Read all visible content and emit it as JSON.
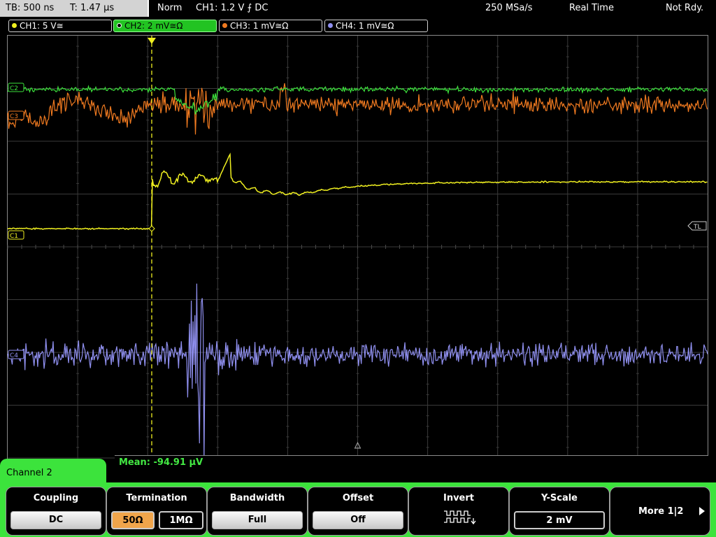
{
  "status": {
    "timebase": "TB: 500 ns",
    "trigger_time": "T: 1.47 µs",
    "trigger_mode": "Norm",
    "trigger_setting": "CH1: 1.2 V ⨍ DC",
    "sample_rate": "250 MSa/s",
    "acq_mode": "Real Time",
    "ready_state": "Not Rdy."
  },
  "channel_tabs": [
    {
      "label": "CH1: 5 V≅",
      "color": "#f0f020"
    },
    {
      "label": "CH2: 2 mV≅Ω",
      "color": "#3ce33c"
    },
    {
      "label": "CH3: 1 mV≅Ω",
      "color": "#f07a20"
    },
    {
      "label": "CH4: 1 mV≅Ω",
      "color": "#9090f0"
    }
  ],
  "markers": {
    "ch2": "C2",
    "ch3": "C3",
    "ch1": "C1",
    "ch4": "C4",
    "trigger_level": "TL"
  },
  "measurement": {
    "label": "Mean: -94.91 µV"
  },
  "menu": {
    "channel_name": "Channel 2",
    "coupling": {
      "title": "Coupling",
      "value": "DC"
    },
    "termination": {
      "title": "Termination",
      "opt1": "50Ω",
      "opt2": "1MΩ",
      "selected": "50Ω"
    },
    "bandwidth": {
      "title": "Bandwidth",
      "value": "Full"
    },
    "offset": {
      "title": "Offset",
      "value": "Off"
    },
    "invert": {
      "title": "Invert"
    },
    "yscale": {
      "title": "Y-Scale",
      "value": "2 mV"
    },
    "more": {
      "label": "More 1|2"
    }
  },
  "colors": {
    "ch1": "#f0f020",
    "ch2": "#3ce33c",
    "ch3": "#f07a20",
    "ch4": "#9090f0",
    "menu_bg": "#3ce33c"
  }
}
